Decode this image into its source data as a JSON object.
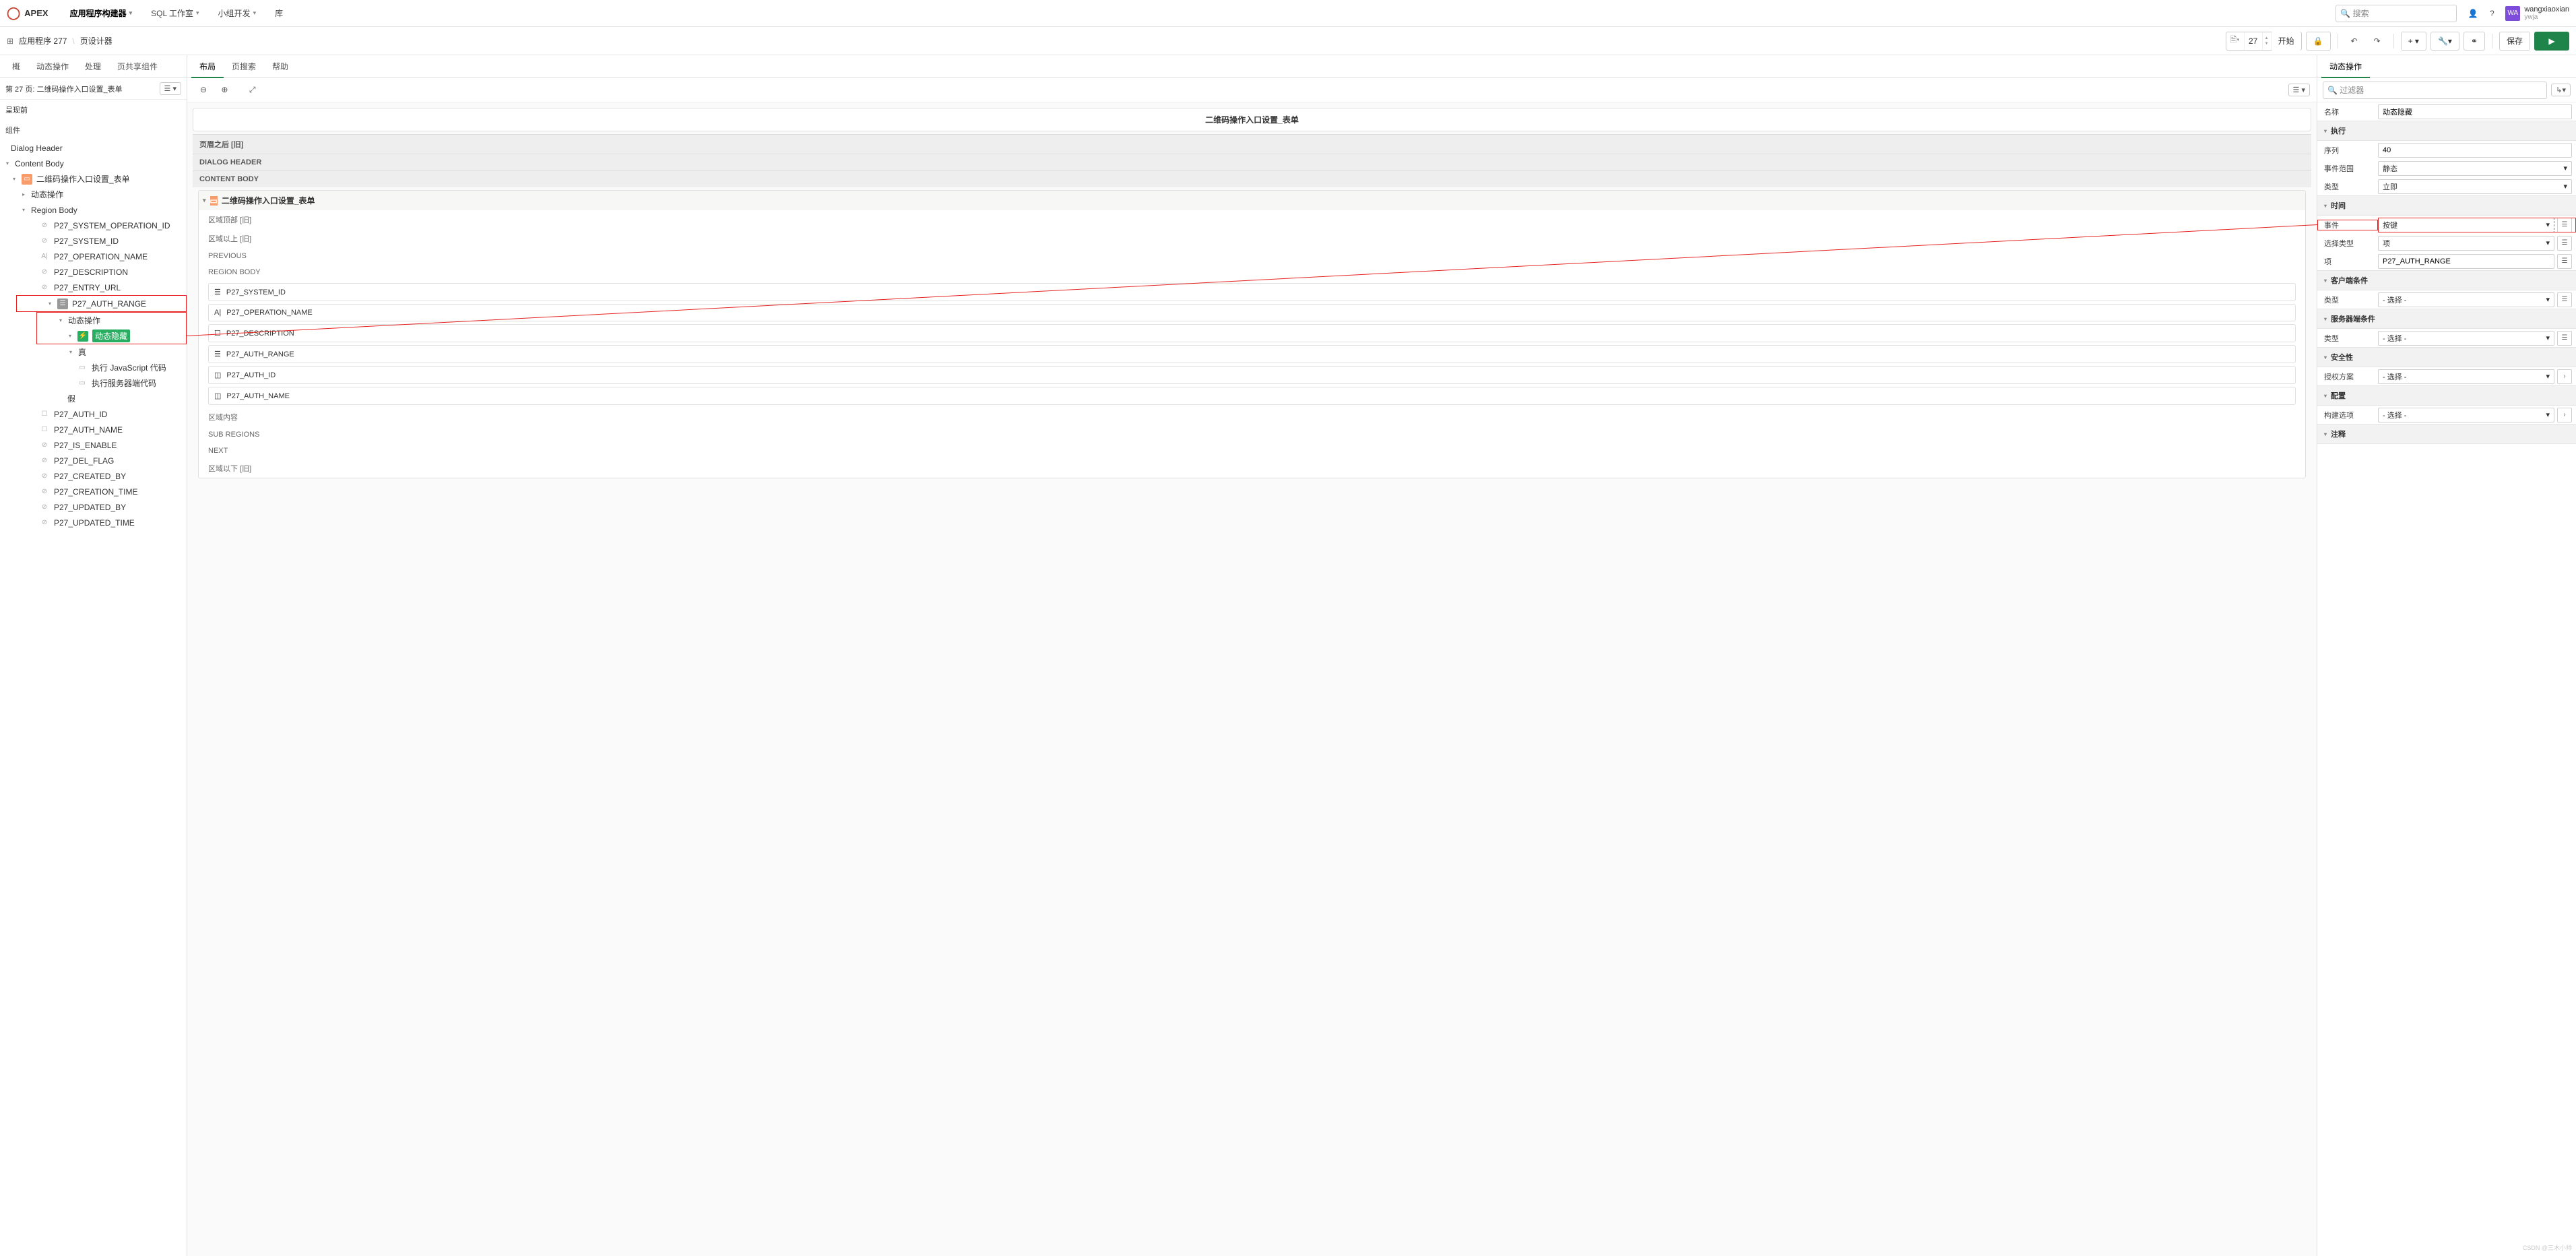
{
  "header": {
    "logo": "APEX",
    "nav": [
      "应用程序构建器",
      "SQL 工作室",
      "小组开发",
      "库"
    ],
    "search_placeholder": "搜索",
    "user": {
      "initials": "WA",
      "name": "wangxiaoxian",
      "sub": "ywja"
    }
  },
  "subheader": {
    "breadcrumb": [
      "应用程序 277",
      "页设计器"
    ],
    "page_number": "27",
    "start_label": "开始",
    "save_label": "保存"
  },
  "left": {
    "tabs": [
      "概",
      "动态操作",
      "处理",
      "页共享组件"
    ],
    "page_label": "第 27 页: 二维码操作入口设置_表单",
    "section_render_before": "呈现前",
    "section_components": "组件",
    "tree": {
      "dialog_header": "Dialog Header",
      "content_body": "Content Body",
      "region_name": "二维码操作入口设置_表单",
      "dynamic_action_label": "动态操作",
      "region_body": "Region Body",
      "items_hidden": [
        "P27_SYSTEM_OPERATION_ID",
        "P27_SYSTEM_ID",
        "P27_OPERATION_NAME",
        "P27_DESCRIPTION",
        "P27_ENTRY_URL"
      ],
      "auth_range": "P27_AUTH_RANGE",
      "da_node": "动态操作",
      "da_action": "动态隐藏",
      "true_label": "真",
      "true_actions": [
        "执行 JavaScript 代码",
        "执行服务器端代码"
      ],
      "false_label": "假",
      "items_after": [
        "P27_AUTH_ID",
        "P27_AUTH_NAME",
        "P27_IS_ENABLE",
        "P27_DEL_FLAG",
        "P27_CREATED_BY",
        "P27_CREATION_TIME",
        "P27_UPDATED_BY",
        "P27_UPDATED_TIME"
      ]
    }
  },
  "center": {
    "tabs": [
      "布局",
      "页搜索",
      "帮助"
    ],
    "form_title": "二维码操作入口设置_表单",
    "sections": {
      "after_header": "页眉之后 [旧]",
      "dialog_header": "DIALOG HEADER",
      "content_body": "CONTENT BODY",
      "region_top": "区域顶部 [旧]",
      "region_above": "区域以上 [旧]",
      "previous": "PREVIOUS",
      "region_body": "REGION BODY",
      "region_content": "区域内容",
      "sub_regions": "SUB REGIONS",
      "next": "NEXT",
      "region_below": "区域以下 [旧]"
    },
    "region_name": "二维码操作入口设置_表单",
    "fields": [
      "P27_SYSTEM_ID",
      "P27_OPERATION_NAME",
      "P27_DESCRIPTION",
      "P27_AUTH_RANGE",
      "P27_AUTH_ID",
      "P27_AUTH_NAME"
    ]
  },
  "right": {
    "tab": "动态操作",
    "filter_placeholder": "过滤器",
    "name_label": "名称",
    "name_value": "动态隐藏",
    "sections": {
      "execute": "执行",
      "time": "时间",
      "client": "客户端条件",
      "server": "服务器端条件",
      "security": "安全性",
      "config": "配置",
      "comment": "注释"
    },
    "fields": {
      "sequence": {
        "label": "序列",
        "value": "40"
      },
      "event_scope": {
        "label": "事件范围",
        "value": "静态"
      },
      "type": {
        "label": "类型",
        "value": "立即"
      },
      "event": {
        "label": "事件",
        "value": "按键"
      },
      "select_type": {
        "label": "选择类型",
        "value": "项"
      },
      "item": {
        "label": "项",
        "value": "P27_AUTH_RANGE"
      },
      "client_type": {
        "label": "类型",
        "value": "- 选择 -"
      },
      "server_type": {
        "label": "类型",
        "value": "- 选择 -"
      },
      "auth": {
        "label": "授权方案",
        "value": "- 选择 -"
      },
      "build": {
        "label": "构建选项",
        "value": "- 选择 -"
      }
    }
  },
  "watermark": "CSDN @三木小帅"
}
